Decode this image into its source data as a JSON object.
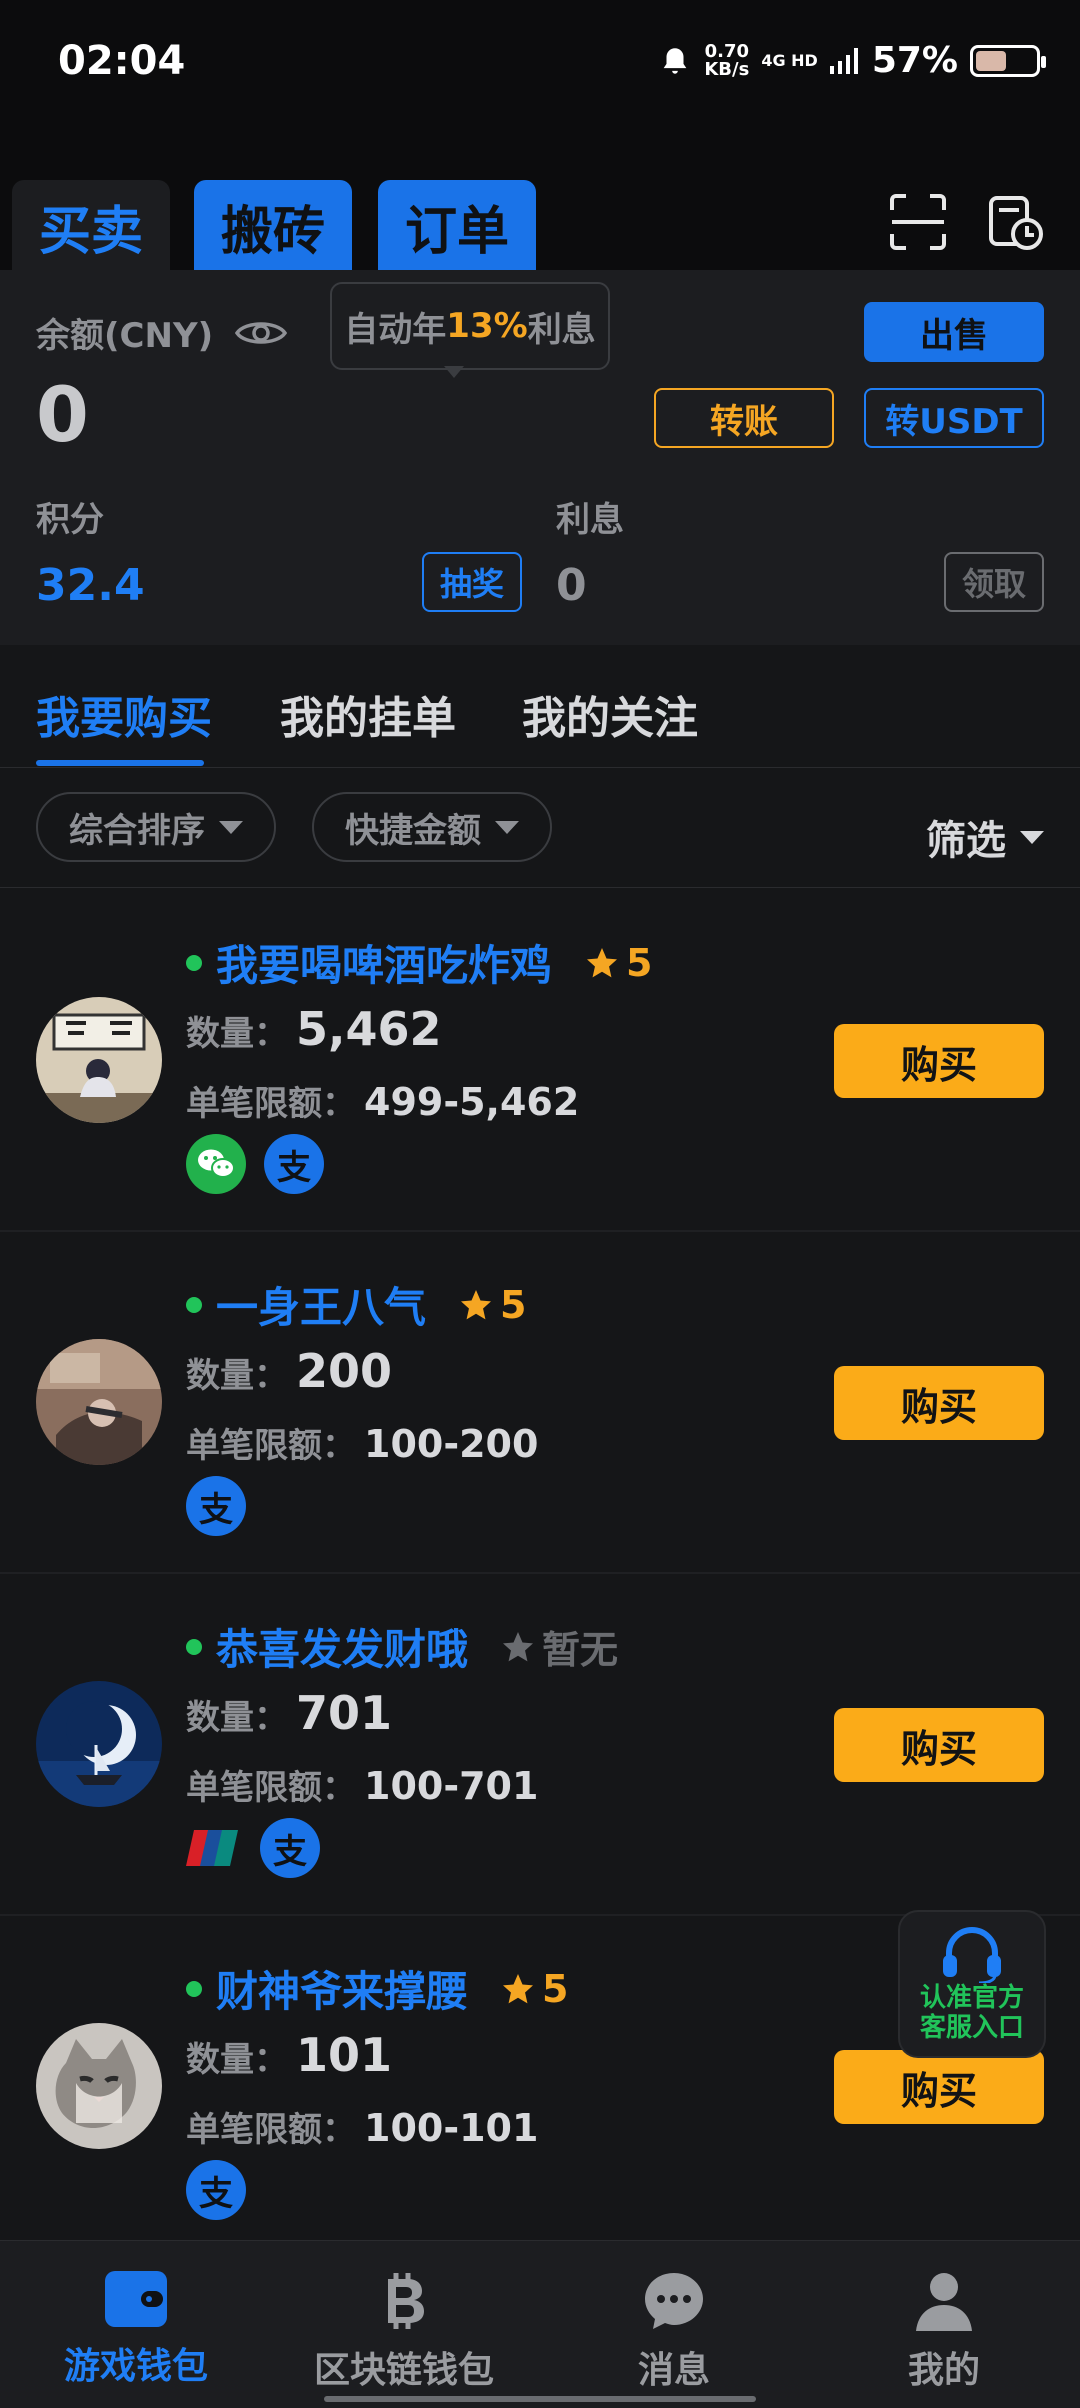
{
  "statusbar": {
    "time": "02:04",
    "speed_top": "0.70",
    "speed_bottom": "KB/s",
    "network": "4G HD",
    "battery_percent": "57%",
    "battery_level": 0.57
  },
  "tabs": [
    {
      "label": "买卖",
      "active": true
    },
    {
      "label": "搬砖"
    },
    {
      "label": "订单"
    }
  ],
  "balance": {
    "label": "余额(CNY)",
    "value": "0",
    "tip_prefix": "自动年",
    "tip_rate": "13%",
    "tip_suffix": "利息",
    "sell_label": "出售",
    "transfer_label": "转账",
    "usdt_label": "转USDT",
    "points_label": "积分",
    "points_value": "32.4",
    "lottery_label": "抽奖",
    "interest_label": "利息",
    "interest_value": "0",
    "claim_label": "领取"
  },
  "subtabs": [
    {
      "label": "我要购买",
      "active": true
    },
    {
      "label": "我的挂单"
    },
    {
      "label": "我的关注"
    }
  ],
  "filters": {
    "sort": "综合排序",
    "quick_amount": "快捷金额",
    "filter": "筛选"
  },
  "labels": {
    "quantity": "数量：",
    "limit": "单笔限额：",
    "buy": "购买"
  },
  "listings": [
    {
      "name": "我要喝啤酒吃炸鸡",
      "rating": "5",
      "quantity": "5,462",
      "limit": "499-5,462",
      "payments": [
        "wechat",
        "alipay"
      ]
    },
    {
      "name": "一身王八气",
      "rating": "5",
      "quantity": "200",
      "limit": "100-200",
      "payments": [
        "alipay"
      ]
    },
    {
      "name": "恭喜发发财哦",
      "rating": "暂无",
      "quantity": "701",
      "limit": "100-701",
      "payments": [
        "unionpay",
        "alipay"
      ]
    },
    {
      "name": "财神爷来撑腰",
      "rating": "5",
      "quantity": "101",
      "limit": "100-101",
      "payments": [
        "alipay"
      ]
    }
  ],
  "service": {
    "line1": "认准官方",
    "line2": "客服入口"
  },
  "bottomnav": [
    {
      "label": "游戏钱包",
      "active": true
    },
    {
      "label": "区块链钱包"
    },
    {
      "label": "消息"
    },
    {
      "label": "我的"
    }
  ],
  "colors": {
    "accent": "#1a73e8",
    "buy": "#fbab18",
    "online": "#21c45a",
    "rating": "#f5a623"
  }
}
